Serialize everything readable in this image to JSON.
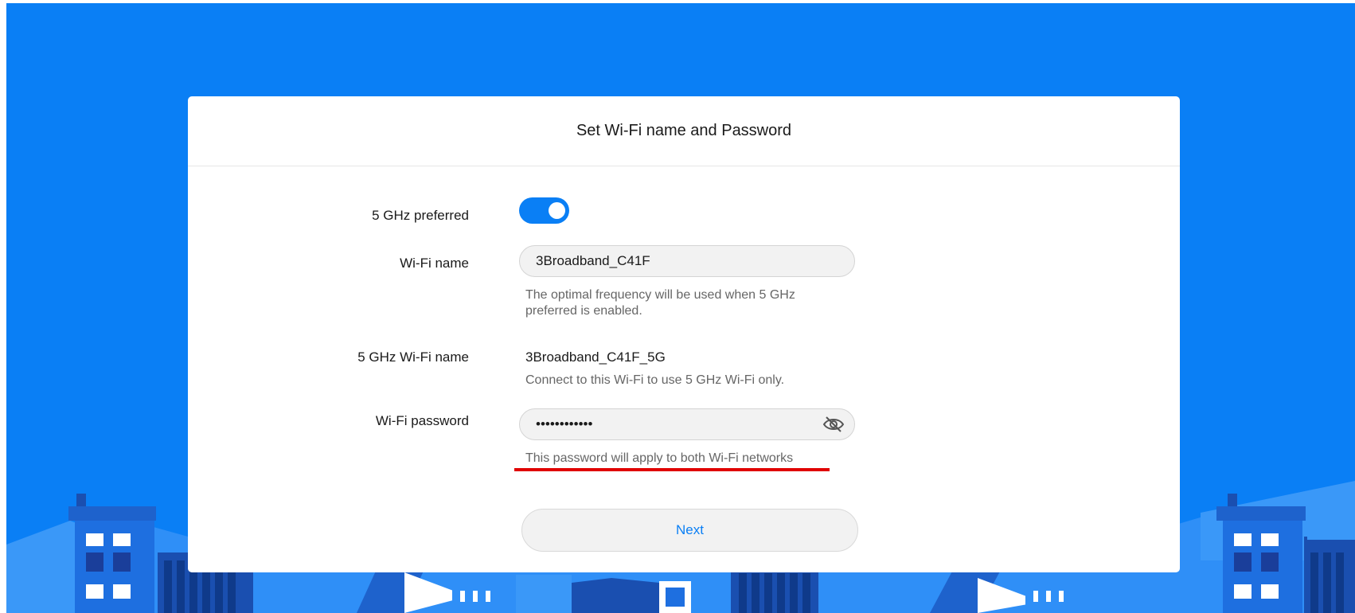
{
  "dialog": {
    "title": "Set Wi-Fi name and Password",
    "five_ghz_preferred": {
      "label": "5 GHz preferred",
      "enabled": true
    },
    "wifi_name": {
      "label": "Wi-Fi name",
      "value": "3Broadband_C41F",
      "hint_line1": "The optimal frequency will be used when 5 GHz",
      "hint_line2": "preferred is enabled."
    },
    "five_ghz_wifi_name": {
      "label": "5 GHz Wi-Fi name",
      "value": "3Broadband_C41F_5G",
      "hint": "Connect to this Wi-Fi to use 5 GHz Wi-Fi only."
    },
    "wifi_password": {
      "label": "Wi-Fi password",
      "value": "••••••••••••",
      "hint": "This password will apply to both Wi-Fi networks",
      "visibility_icon": "eye-slash-icon"
    },
    "next_label": "Next"
  },
  "colors": {
    "brand_blue": "#0a7ff5",
    "highlight_red": "#e00000"
  }
}
